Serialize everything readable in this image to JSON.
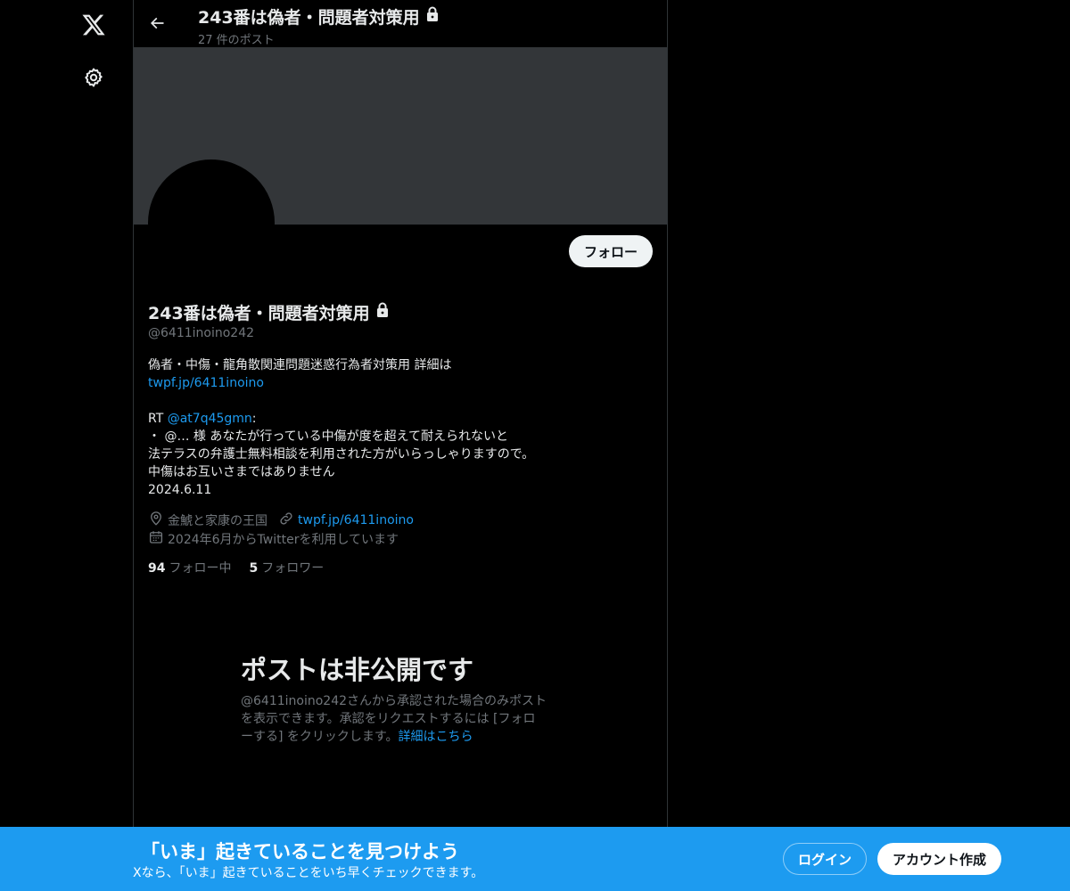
{
  "nav": {
    "logo_icon": "x-logo-icon",
    "settings_icon": "gear-icon"
  },
  "header": {
    "title": "243番は偽者・問題者対策用",
    "post_count": "27 件のポスト"
  },
  "profile": {
    "follow_label": "フォロー",
    "display_name": "243番は偽者・問題者対策用",
    "handle": "@6411inoino242",
    "bio": {
      "line1": "偽者・中傷・龍角散関連問題迷惑行為者対策用 詳細は",
      "link1": "twpf.jp/6411inoino",
      "rt_prefix": "RT ",
      "rt_mention": "@at7q45gmn",
      "rt_colon": ":",
      "line3": "・ @… 様 あなたが行っている中傷が度を超えて耐えられないと",
      "line4": "法テラスの弁護士無料相談を利用された方がいらっしゃりますので。",
      "line5": "中傷はお互いさまではありません",
      "line6": "2024.6.11"
    },
    "location": "金鯱と家康の王国",
    "website": "twpf.jp/6411inoino",
    "joined": "2024年6月からTwitterを利用しています",
    "following_count": "94",
    "following_label": "フォロー中",
    "followers_count": "5",
    "followers_label": "フォロワー"
  },
  "private_notice": {
    "title": "ポストは非公開です",
    "line1": "@6411inoino242さんから承認された場合のみポスト",
    "line2": "を表示できます。承認をリクエストするには [フォロ",
    "line3": "ーする] をクリックします。",
    "learn_more": "詳細はこちら"
  },
  "bottom_bar": {
    "title": "「いま」起きていることを見つけよう",
    "subtitle": "Xなら、「いま」起きていることをいち早くチェックできます。",
    "login_label": "ログイン",
    "signup_label": "アカウント作成"
  },
  "colors": {
    "background": "#000000",
    "accent": "#1d9bf0",
    "banner": "#333639",
    "muted_text": "#71767b"
  }
}
